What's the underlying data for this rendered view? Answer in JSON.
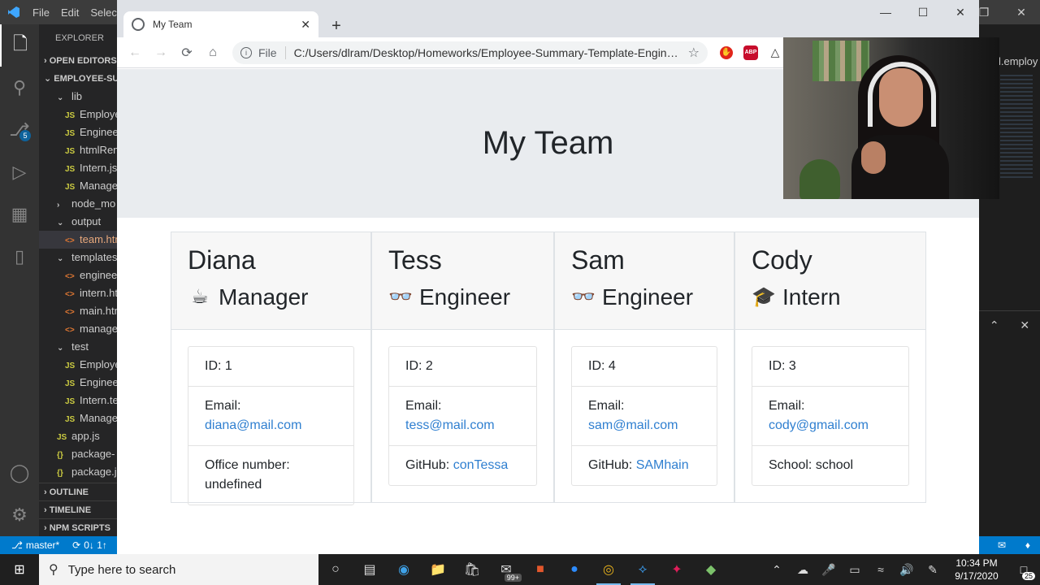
{
  "vscode": {
    "menu": [
      "File",
      "Edit",
      "Selec"
    ],
    "explorer_title": "EXPLORER",
    "open_editors": "OPEN EDITORS",
    "project": "EMPLOYEE-SU",
    "scm_badge": "5",
    "tree": [
      {
        "kind": "folder",
        "label": "lib"
      },
      {
        "kind": "js",
        "label": "Employe"
      },
      {
        "kind": "js",
        "label": "Enginee"
      },
      {
        "kind": "js",
        "label": "htmlRen"
      },
      {
        "kind": "js",
        "label": "Intern.js"
      },
      {
        "kind": "js",
        "label": "Manage"
      },
      {
        "kind": "folder-closed",
        "label": "node_mo"
      },
      {
        "kind": "folder",
        "label": "output"
      },
      {
        "kind": "html",
        "label": "team.htm"
      },
      {
        "kind": "folder",
        "label": "templates"
      },
      {
        "kind": "html",
        "label": "enginee"
      },
      {
        "kind": "html",
        "label": "intern.ht"
      },
      {
        "kind": "html",
        "label": "main.htm"
      },
      {
        "kind": "html",
        "label": "manage"
      },
      {
        "kind": "folder",
        "label": "test"
      },
      {
        "kind": "js",
        "label": "Employe"
      },
      {
        "kind": "js",
        "label": "Enginee"
      },
      {
        "kind": "js",
        "label": "Intern.te"
      },
      {
        "kind": "js",
        "label": "Manage"
      },
      {
        "kind": "js",
        "label": "app.js"
      },
      {
        "kind": "json",
        "label": "package-"
      },
      {
        "kind": "json",
        "label": "package.j"
      }
    ],
    "outline": "OUTLINE",
    "timeline": "TIMELINE",
    "npm_scripts": "NPM SCRIPTS",
    "right_tab_file": "l.employ",
    "status_branch": "master*",
    "status_sync": "0↓ 1↑"
  },
  "browser": {
    "tab_title": "My Team",
    "scheme_label": "File",
    "url": "C:/Users/dlram/Desktop/Homeworks/Employee-Summary-Template-Engine...",
    "abp_label": "ABP"
  },
  "page": {
    "heading": "My Team",
    "cards": [
      {
        "name": "Diana",
        "role": "Manager",
        "role_icon": "coffee-icon",
        "id_text": "ID: 1",
        "email_label": "Email:",
        "email": "diana@mail.com",
        "extra_label": "Office number:",
        "extra_value": "undefined",
        "extra_is_link": false
      },
      {
        "name": "Tess",
        "role": "Engineer",
        "role_icon": "glasses-icon",
        "id_text": "ID: 2",
        "email_label": "Email:",
        "email": "tess@mail.com",
        "extra_label": "GitHub:",
        "extra_value": "conTessa",
        "extra_is_link": true
      },
      {
        "name": "Sam",
        "role": "Engineer",
        "role_icon": "glasses-icon",
        "id_text": "ID: 4",
        "email_label": "Email:",
        "email": "sam@mail.com",
        "extra_label": "GitHub:",
        "extra_value": "SAMhain",
        "extra_is_link": true
      },
      {
        "name": "Cody",
        "role": "Intern",
        "role_icon": "graduate-icon",
        "id_text": "ID: 3",
        "email_label": "Email:",
        "email": "cody@gmail.com",
        "extra_label": "School:",
        "extra_value": "school",
        "extra_is_link": false
      }
    ]
  },
  "taskbar": {
    "search_placeholder": "Type here to search",
    "mail_badge": "99+",
    "time": "10:34 PM",
    "date": "9/17/2020",
    "notification_count": "25"
  },
  "colors": {
    "link": "#2f7fd0",
    "jumbotron_bg": "#e9ecef",
    "vscode_status": "#007acc"
  }
}
